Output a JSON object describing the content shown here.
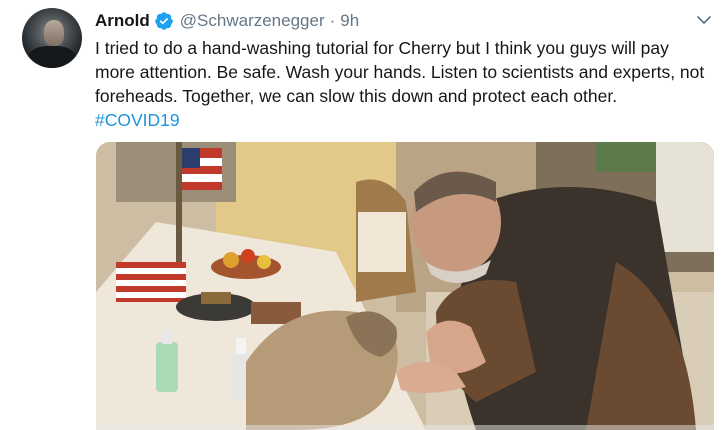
{
  "tweet": {
    "author_name": "Arnold",
    "handle": "@Schwarzenegger",
    "separator": "·",
    "timestamp": "9h",
    "text": "I tried to do a hand-washing tutorial for Cherry but I think you guys will pay more attention. Be safe. Wash your hands. Listen to scientists and experts, not foreheads. Together, we can slow this down and protect each other.",
    "hashtag": "#COVID19",
    "verified": true,
    "colors": {
      "text": "#14171a",
      "secondary": "#657786",
      "link": "#1b95e0",
      "verified_badge": "#1da1f2"
    }
  },
  "icons": {
    "verified": "verified-badge-icon",
    "menu": "chevron-down-icon"
  }
}
